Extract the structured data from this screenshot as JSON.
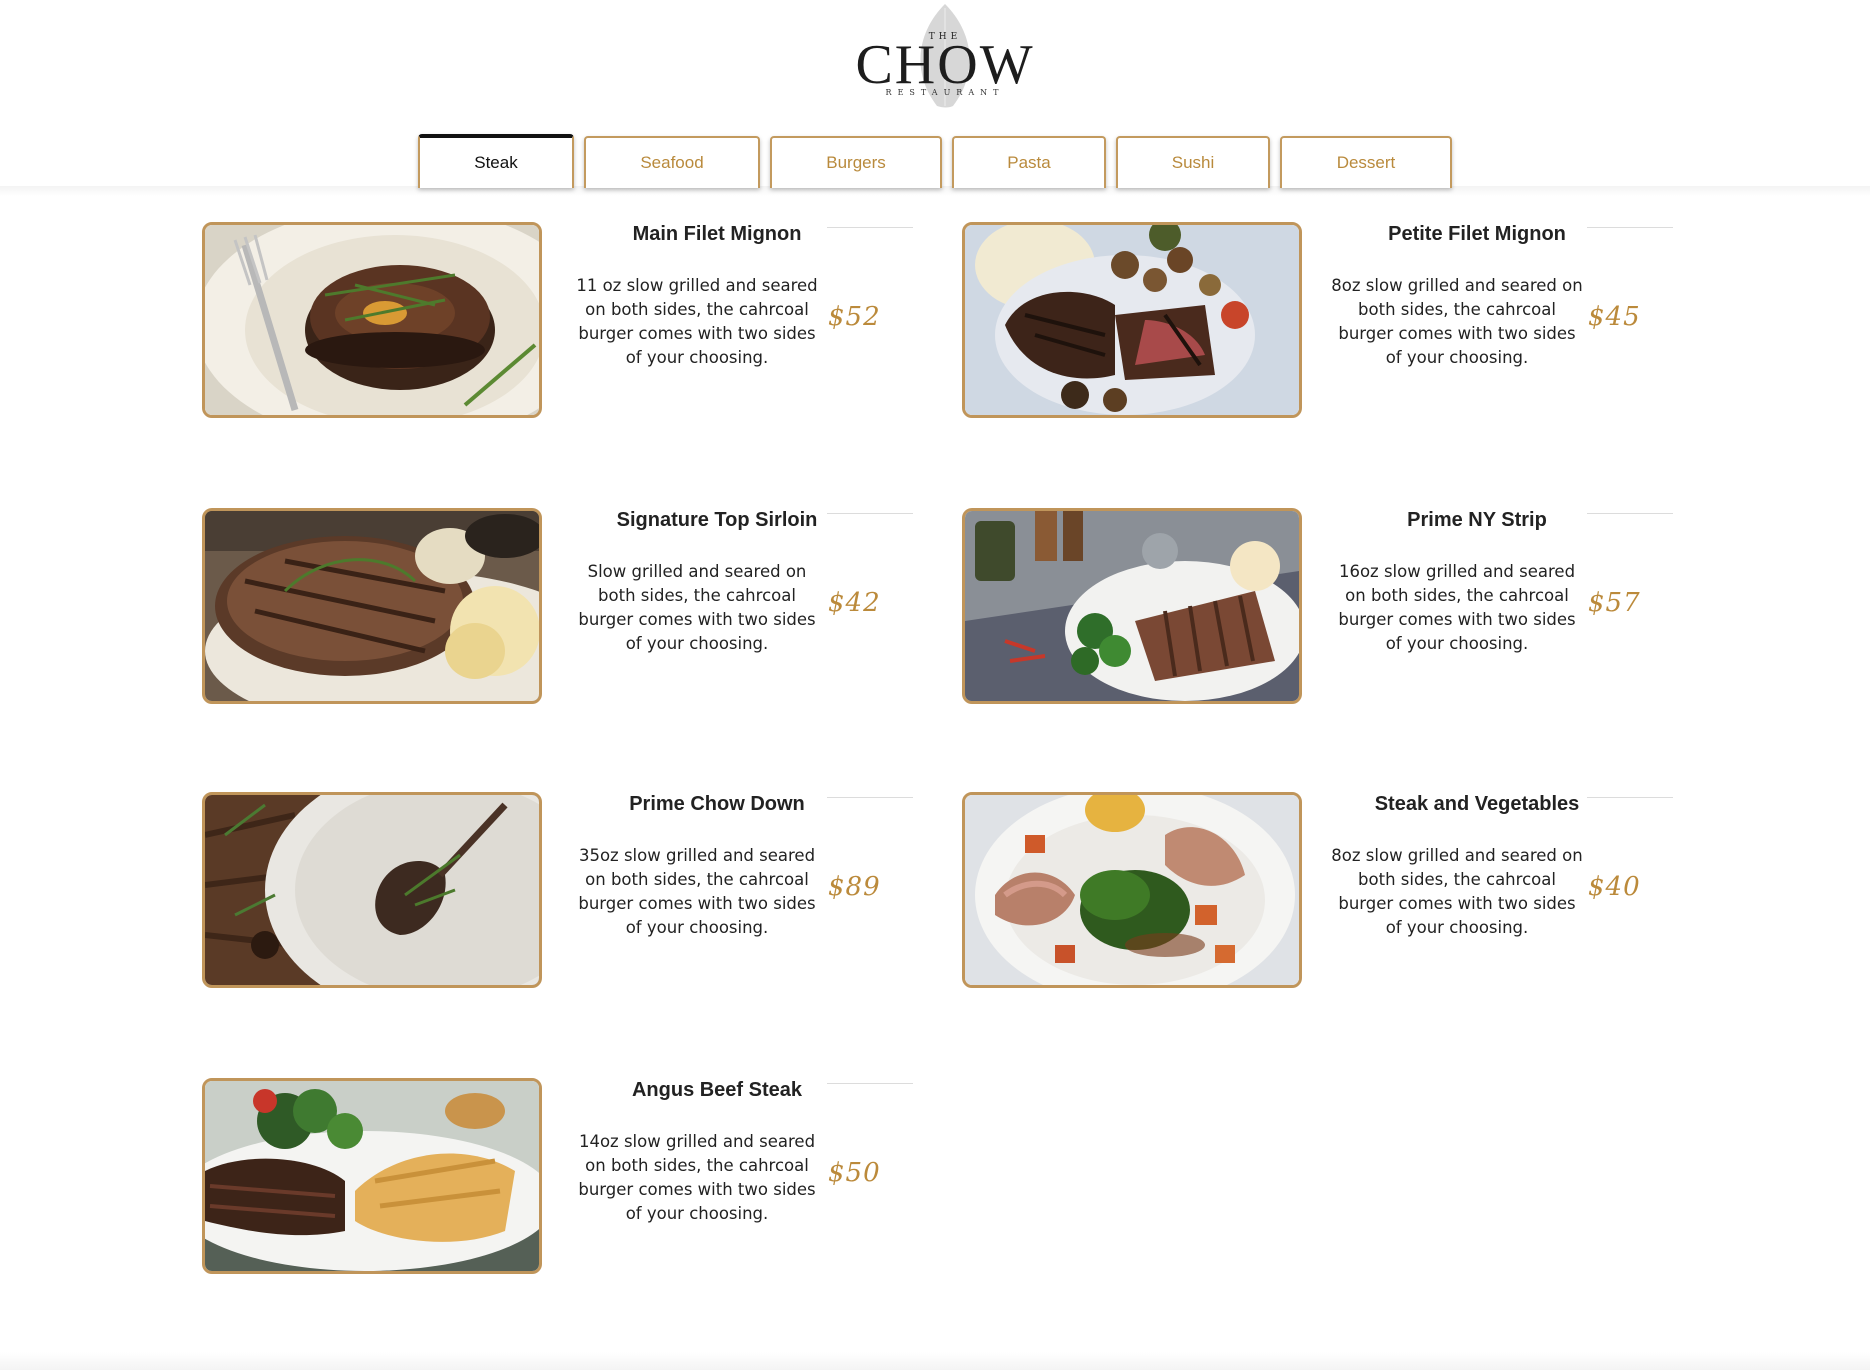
{
  "brand": {
    "top": "THE",
    "name": "CHOW",
    "bottom": "RESTAURANT",
    "accent_color": "#c0955a"
  },
  "tabs": [
    {
      "label": "Steak",
      "active": true
    },
    {
      "label": "Seafood",
      "active": false
    },
    {
      "label": "Burgers",
      "active": false
    },
    {
      "label": "Pasta",
      "active": false
    },
    {
      "label": "Sushi",
      "active": false
    },
    {
      "label": "Dessert",
      "active": false
    }
  ],
  "menu": [
    {
      "name": "Main Filet Mignon",
      "description": "11 oz slow grilled and seared on both sides, the cahrcoal burger comes with two sides of your choosing.",
      "price": "$52",
      "image": "filet-steak-photo"
    },
    {
      "name": "Petite Filet Mignon",
      "description": "8oz slow grilled and seared on both sides, the cahrcoal burger comes with two sides of your choosing.",
      "price": "$45",
      "image": "sliced-steak-mushrooms-photo"
    },
    {
      "name": "Signature Top Sirloin",
      "description": "Slow grilled and seared on both sides, the cahrcoal burger comes with two sides of your choosing.",
      "price": "$42",
      "image": "sirloin-potatoes-photo"
    },
    {
      "name": "Prime NY Strip",
      "description": "16oz slow grilled and seared on both sides, the cahrcoal burger comes with two sides of your choosing.",
      "price": "$57",
      "image": "strip-steak-plate-photo"
    },
    {
      "name": "Prime Chow Down",
      "description": "35oz slow grilled and seared on both sides, the cahrcoal burger comes with two sides of your choosing.",
      "price": "$89",
      "image": "tomahawk-plate-photo"
    },
    {
      "name": "Steak and Vegetables",
      "description": "8oz slow grilled and seared on both sides, the cahrcoal burger comes with two sides of your choosing.",
      "price": "$40",
      "image": "steak-vegetables-photo"
    },
    {
      "name": "Angus Beef Steak",
      "description": "14oz slow grilled and seared on both sides, the cahrcoal burger comes with two sides of your choosing.",
      "price": "$50",
      "image": "angus-steak-bread-photo"
    }
  ]
}
